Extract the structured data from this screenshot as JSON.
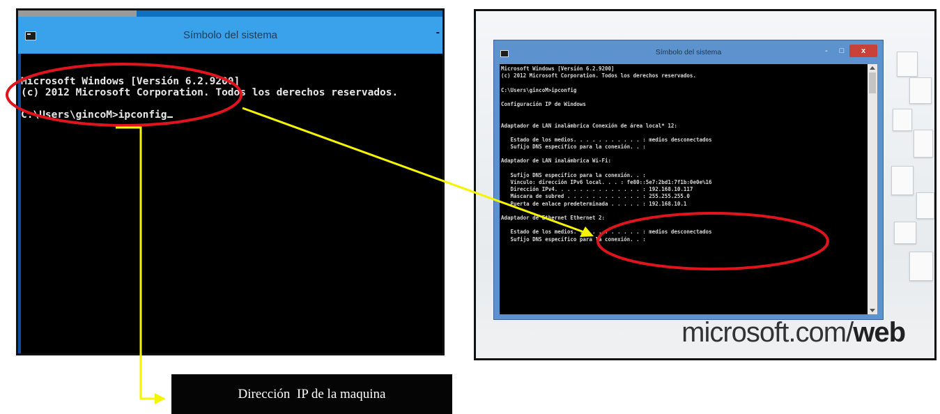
{
  "left_window": {
    "title": "Símbolo del sistema",
    "minimize_glyph": "-",
    "lines": [
      "Microsoft Windows [Versión 6.2.9200]",
      "(c) 2012 Microsoft Corporation. Todos los derechos reservados.",
      "",
      "C:\\Users\\gincoM>ipconfig"
    ]
  },
  "right_window": {
    "title": "Símbolo del sistema",
    "controls": {
      "minimize": "-",
      "maximize": "□",
      "close": "x"
    },
    "lines": [
      "Microsoft Windows [Versión 6.2.9200]",
      "(c) 2012 Microsoft Corporation. Todos los derechos reservados.",
      "",
      "C:\\Users\\gincoM>ipconfig",
      "",
      "Configuración IP de Windows",
      "",
      "",
      "Adaptador de LAN inalámbrica Conexión de área local* 12:",
      "",
      "   Estado de los medios. . . . . . . . . . . : medios desconectados",
      "   Sufijo DNS específico para la conexión. . :",
      "",
      "Adaptador de LAN inalámbrica Wi-Fi:",
      "",
      "   Sufijo DNS específico para la conexión. . :",
      "   Vínculo: dirección IPv6 local. . . : fe80::5e7:2bd1:7f1b:0e0e%16",
      "   Dirección IPv4. . . . . . . . . . . . . . : 192.168.10.117",
      "   Máscara de subred . . . . . . . . . . . . : 255.255.255.0",
      "   Puerta de enlace predeterminada . . . . . : 192.168.10.1",
      "",
      "Adaptador de Ethernet Ethernet 2:",
      "",
      "   Estado de los medios. . . . . . . . . . . : medios desconectados",
      "   Sufijo DNS específico para la conexión. . :"
    ]
  },
  "brand": {
    "prefix": "microsoft.com/",
    "suffix": "web"
  },
  "label": "Dirección  IP de la maquina",
  "colors": {
    "annotation_ellipse": "#e0141c",
    "connector_arrow": "#f5f500",
    "left_titlebar": "#3aa2ea",
    "right_titlebar": "#5c93cf",
    "close_button": "#c8423a"
  }
}
